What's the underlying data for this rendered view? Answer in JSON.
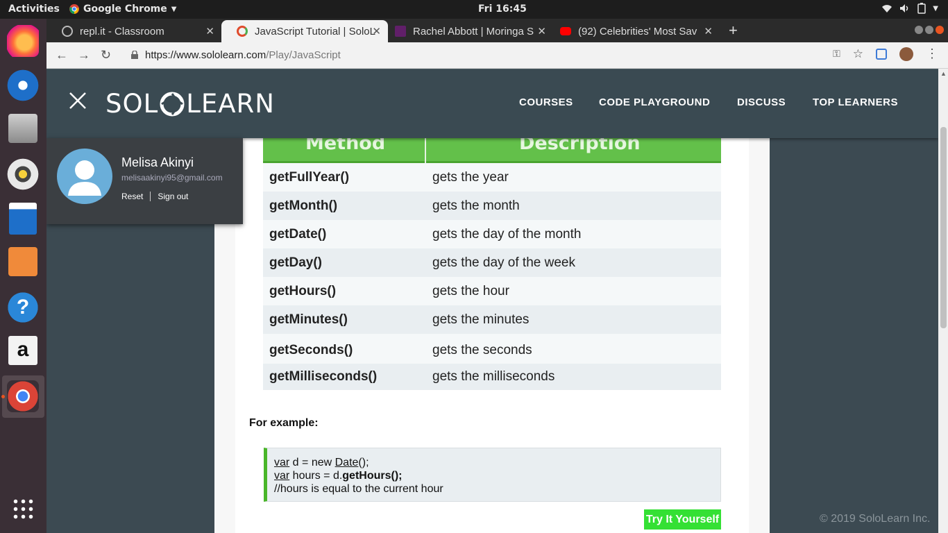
{
  "system": {
    "activities": "Activities",
    "app_menu": "Google Chrome",
    "clock": "Fri 16:45"
  },
  "tabs": [
    {
      "title": "repl.it - Classroom",
      "favicon_color": "#7a7a7a"
    },
    {
      "title": "JavaScript Tutorial | SoloL",
      "favicon_color": "#e04b2c"
    },
    {
      "title": "Rachel Abbott | Moringa S",
      "favicon_color": "#4a154b"
    },
    {
      "title": "(92) Celebrities' Most Sav",
      "favicon_color": "#ff0000"
    }
  ],
  "address": {
    "host": "https://www.sololearn.com",
    "path": "/Play/JavaScript"
  },
  "header": {
    "logo_left": "SOL",
    "logo_right": "LEARN",
    "nav": [
      "COURSES",
      "CODE PLAYGROUND",
      "DISCUSS",
      "TOP LEARNERS"
    ]
  },
  "profile": {
    "name": "Melisa Akinyi",
    "email": "melisaakinyi95@gmail.com",
    "reset": "Reset",
    "sign_out": "Sign out"
  },
  "table": {
    "headers": [
      "Method",
      "Description"
    ],
    "rows": [
      {
        "method": "getFullYear()",
        "description": "gets the year"
      },
      {
        "method": "getMonth()",
        "description": "gets the month"
      },
      {
        "method": "getDate()",
        "description": "gets the day of the month"
      },
      {
        "method": "getDay()",
        "description": "gets the day of the week"
      },
      {
        "method": "getHours()",
        "description": "gets the hour"
      },
      {
        "method": "getMinutes()",
        "description": "gets the minutes"
      },
      {
        "method": "getSeconds()",
        "description": "gets the seconds"
      },
      {
        "method": "getMilliseconds()",
        "description": "gets the milliseconds"
      }
    ]
  },
  "example": {
    "label": "For example:",
    "kw": "var",
    "line1_rest_a": " d = new ",
    "line1_date": "Date",
    "line1_rest_b": "();",
    "line2_rest": " hours = d.",
    "line2_bold": "getHours();",
    "line3": "//hours is equal to the current hour"
  },
  "try_button": "Try It Yourself",
  "copyright": "© 2019 SoloLearn Inc.",
  "colors": {
    "accent_green": "#63c04a",
    "button_green": "#34e034",
    "header_bg": "#3a4a52"
  }
}
